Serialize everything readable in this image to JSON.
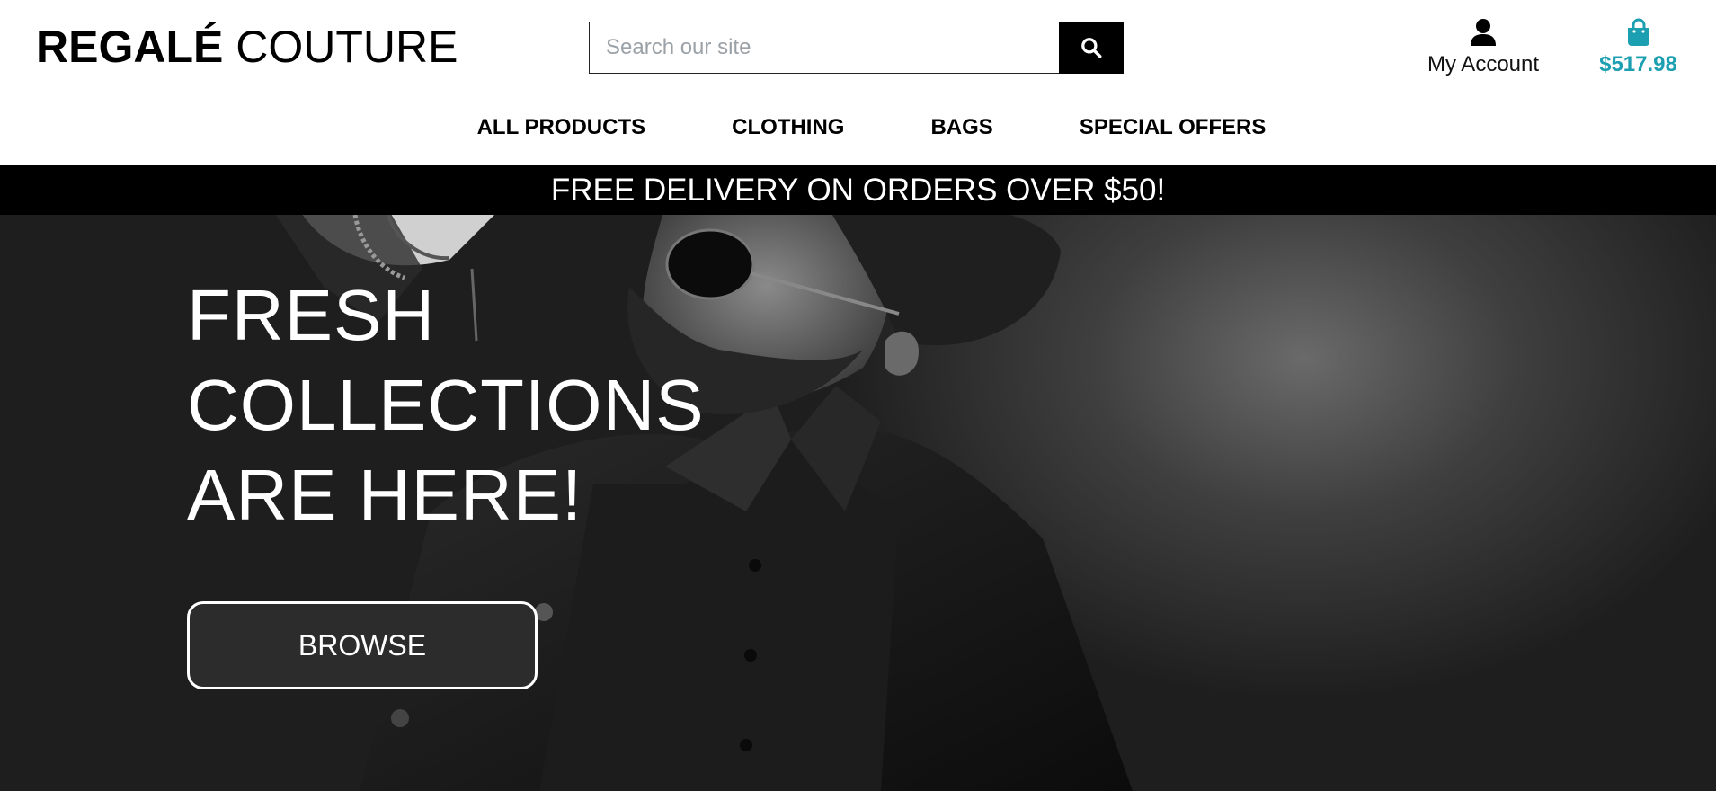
{
  "brand": {
    "name_bold": "REGALÉ",
    "name_light": "COUTURE"
  },
  "search": {
    "placeholder": "Search our site",
    "value": "",
    "button_icon": "search-icon"
  },
  "account": {
    "label": "My Account",
    "icon": "user-icon"
  },
  "bag": {
    "total": "$517.98",
    "icon": "shopping-bag-icon",
    "accent": "#1c9fb0"
  },
  "nav": {
    "items": [
      {
        "label": "ALL PRODUCTS"
      },
      {
        "label": "CLOTHING"
      },
      {
        "label": "BAGS"
      },
      {
        "label": "SPECIAL OFFERS"
      }
    ]
  },
  "banner": {
    "text": "FREE DELIVERY ON ORDERS OVER $50!"
  },
  "hero": {
    "headline": [
      "FRESH",
      "COLLECTIONS",
      "ARE HERE!"
    ],
    "cta_label": "BROWSE"
  },
  "colors": {
    "accent": "#1c9fb0",
    "banner_bg": "#000000",
    "cta_bg": "#2c2c2c"
  }
}
